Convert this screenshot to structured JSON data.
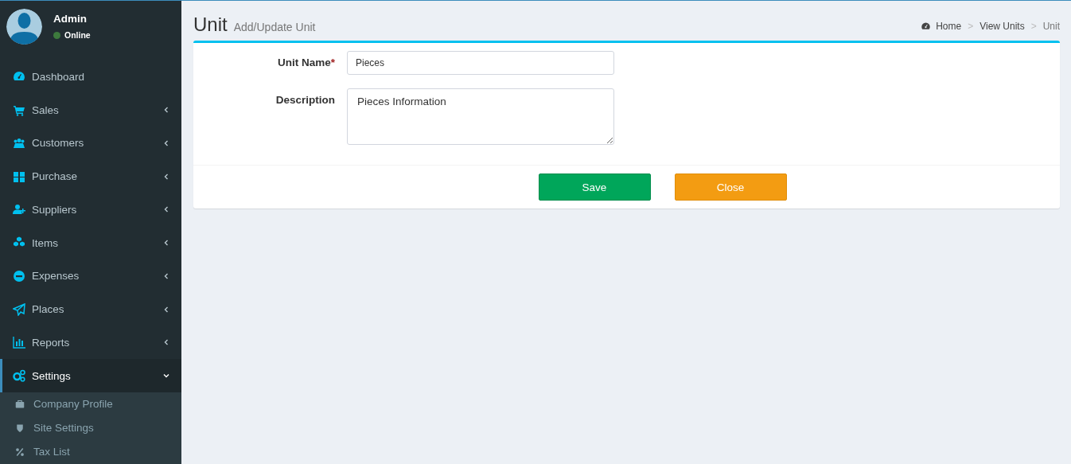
{
  "user": {
    "name": "Admin",
    "status": "Online",
    "online": true
  },
  "menu": [
    {
      "label": "Dashboard",
      "expandable": false,
      "expanded": false,
      "selected": false
    },
    {
      "label": "Sales",
      "expandable": true,
      "expanded": false,
      "selected": false
    },
    {
      "label": "Customers",
      "expandable": true,
      "expanded": false,
      "selected": false
    },
    {
      "label": "Purchase",
      "expandable": true,
      "expanded": false,
      "selected": false
    },
    {
      "label": "Suppliers",
      "expandable": true,
      "expanded": false,
      "selected": false
    },
    {
      "label": "Items",
      "expandable": true,
      "expanded": false,
      "selected": false
    },
    {
      "label": "Expenses",
      "expandable": true,
      "expanded": false,
      "selected": false
    },
    {
      "label": "Places",
      "expandable": true,
      "expanded": false,
      "selected": false
    },
    {
      "label": "Reports",
      "expandable": true,
      "expanded": false,
      "selected": false
    },
    {
      "label": "Settings",
      "expandable": true,
      "expanded": true,
      "selected": true,
      "children": [
        {
          "label": "Company Profile"
        },
        {
          "label": "Site Settings"
        },
        {
          "label": "Tax List"
        }
      ]
    }
  ],
  "page": {
    "title": "Unit",
    "subtitle": "Add/Update Unit"
  },
  "breadcrumb": [
    {
      "label": "Home"
    },
    {
      "separator": ">",
      "label": "View Units"
    },
    {
      "separator": ">",
      "label": "Unit"
    }
  ],
  "form": {
    "fields": [
      {
        "kind": "text",
        "label": "Unit Name",
        "required": true,
        "value": "Pieces"
      },
      {
        "kind": "textarea",
        "label": "Description",
        "required": false,
        "value": "Pieces Information"
      }
    ],
    "required_mark": "*",
    "buttons": [
      {
        "label": "Save",
        "kind": "success"
      },
      {
        "label": "Close",
        "kind": "warning"
      }
    ]
  }
}
